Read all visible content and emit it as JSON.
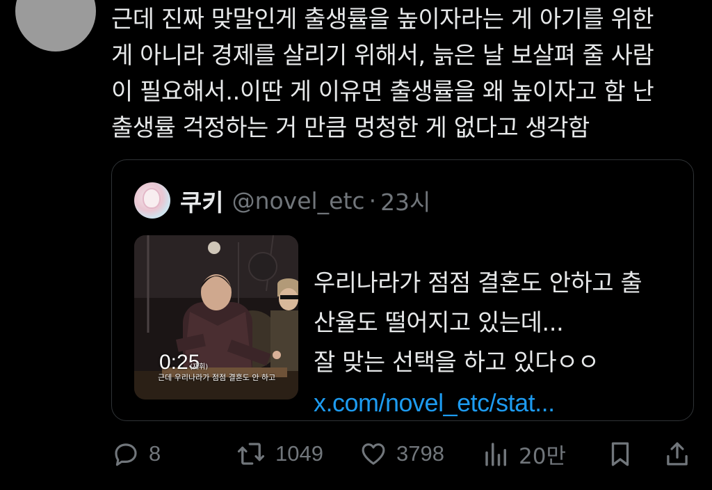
{
  "tweet": {
    "text": "근데 진짜 맞말인게 출생률을 높이자라는 게 아기를 위한\n게 아니라 경제를 살리기 위해서, 늙은 날 보살펴 줄 사람\n이 필요해서..이딴 게 이유면 출생률을 왜 높이자고 함 난\n출생률 걱정하는 거 만큼 멍청한 게 없다고 생각함"
  },
  "quote": {
    "name": "쿠키",
    "handle": "@novel_etc",
    "separator": "·",
    "time": "23시",
    "text": "우리나라가 점점 결혼도 안하고 출\n산율도 떨어지고 있는데...\n잘 맞는 선택을 하고 있다ㅇㅇ",
    "link": "x.com/novel_etc/stat...",
    "video": {
      "duration": "0:25",
      "caption_prefix": "(재휘)",
      "caption": "근데 우리나라가 점점 결혼도 안 하고"
    }
  },
  "actions": {
    "replies": "8",
    "reposts": "1049",
    "likes": "3798",
    "views": "20만"
  },
  "colors": {
    "background": "#000000",
    "text": "#e7e9ea",
    "muted": "#71767b",
    "link": "#1d9bf0",
    "border": "#2f3336"
  }
}
